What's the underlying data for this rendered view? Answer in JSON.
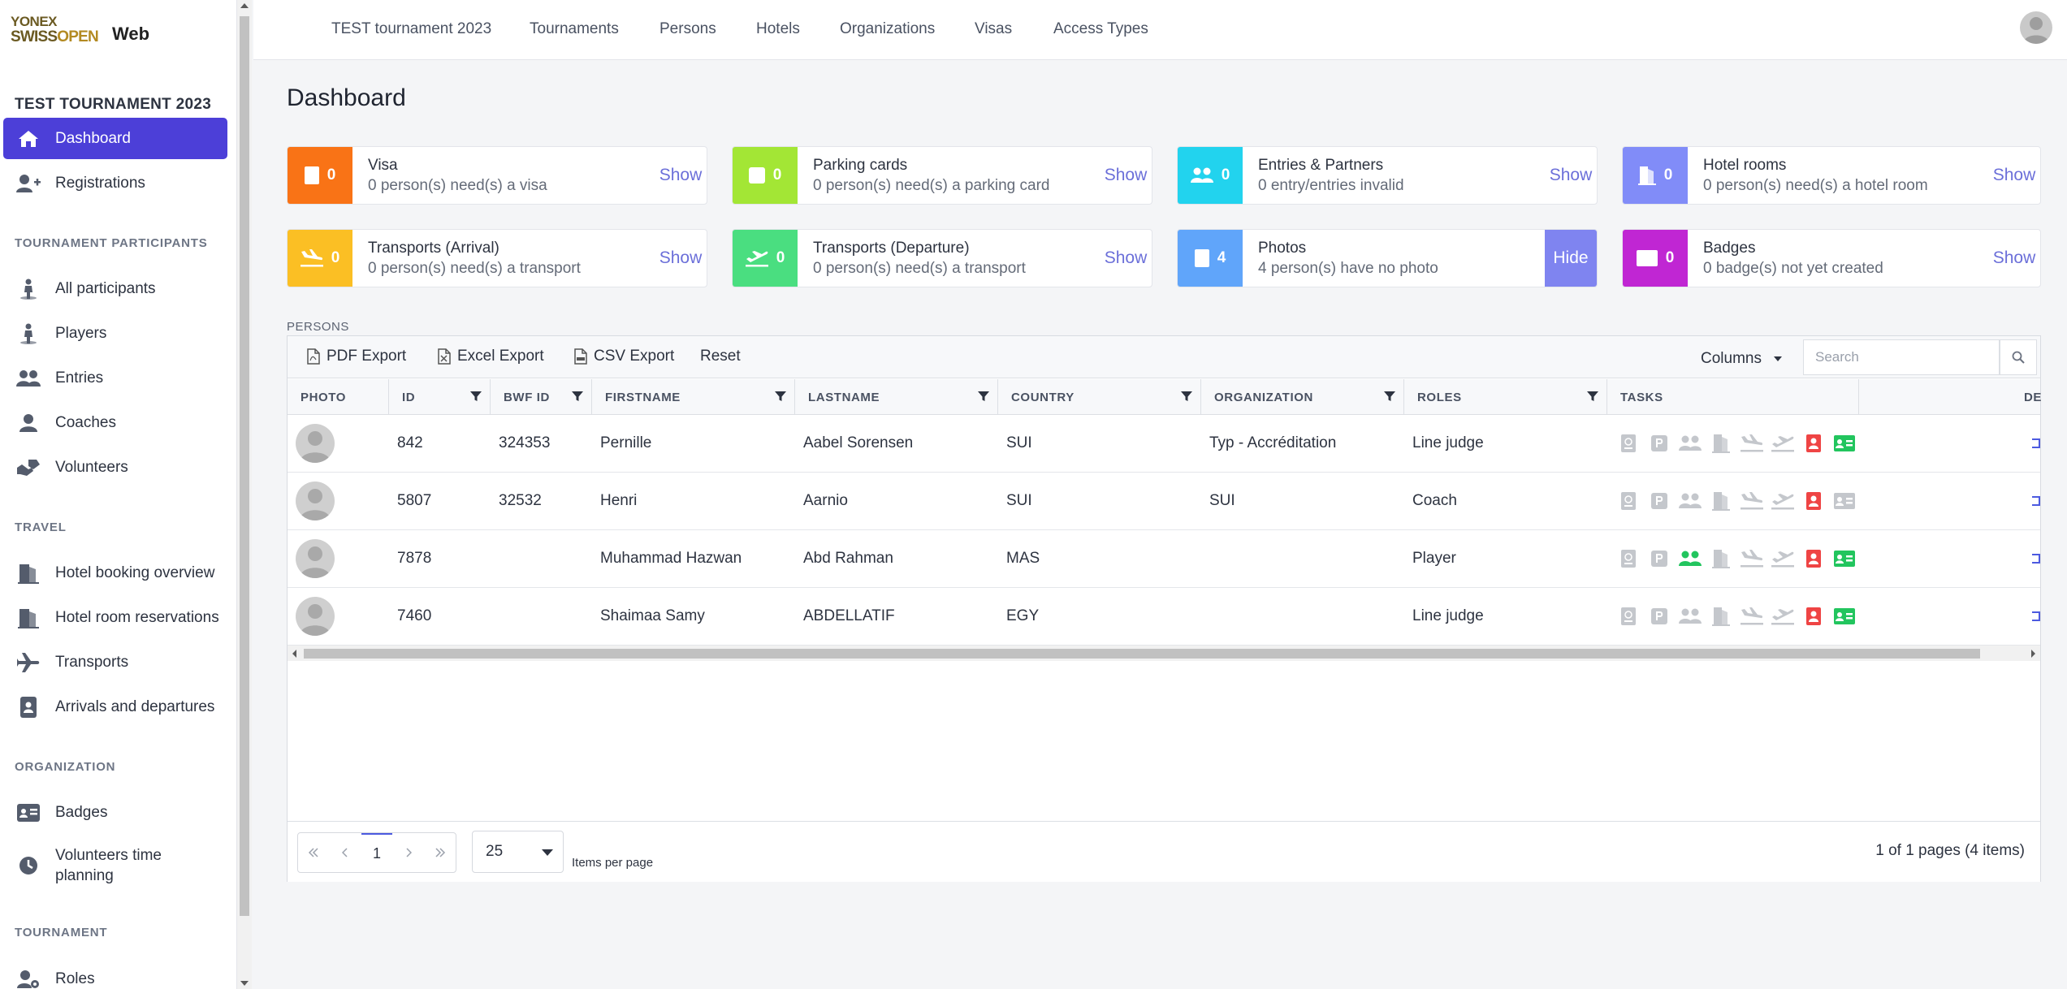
{
  "sidebar": {
    "logo_line1": "YONEX",
    "logo_line2a": "SWISS",
    "logo_line2b": "OPEN",
    "app_name": "Web",
    "tournament_title": "TEST TOURNAMENT 2023",
    "items": [
      {
        "label": "Dashboard",
        "icon": "home-icon",
        "active": true
      },
      {
        "label": "Registrations",
        "icon": "user-plus-icon"
      },
      {
        "label": "All participants",
        "icon": "person-icon"
      },
      {
        "label": "Players",
        "icon": "person-icon"
      },
      {
        "label": "Entries",
        "icon": "users-icon"
      },
      {
        "label": "Coaches",
        "icon": "user-icon"
      },
      {
        "label": "Volunteers",
        "icon": "hands-helping-icon"
      },
      {
        "label": "Hotel booking overview",
        "icon": "hotel-icon"
      },
      {
        "label": "Hotel room reservations",
        "icon": "hotel-icon"
      },
      {
        "label": "Transports",
        "icon": "plane-icon"
      },
      {
        "label": "Arrivals and departures",
        "icon": "id-badge-icon"
      },
      {
        "label": "Badges",
        "icon": "id-card-icon"
      },
      {
        "label": "Volunteers time planning",
        "icon": "clock-icon"
      },
      {
        "label": "Roles",
        "icon": "user-cog-icon"
      }
    ],
    "sections": {
      "participants": "TOURNAMENT PARTICIPANTS",
      "travel": "TRAVEL",
      "organization": "ORGANIZATION",
      "tournament": "TOURNAMENT"
    }
  },
  "topnav": {
    "links": [
      "TEST tournament 2023",
      "Tournaments",
      "Persons",
      "Hotels",
      "Organizations",
      "Visas",
      "Access Types"
    ]
  },
  "page_title": "Dashboard",
  "cards": [
    {
      "title": "Visa",
      "subtitle": "0 person(s) need(s) a visa",
      "count": "0",
      "action": "Show",
      "color": "#f97316",
      "icon": "passport-icon"
    },
    {
      "title": "Parking cards",
      "subtitle": "0 person(s) need(s) a parking card",
      "count": "0",
      "action": "Show",
      "color": "#a3e635",
      "icon": "parking-icon"
    },
    {
      "title": "Entries & Partners",
      "subtitle": "0 entry/entries invalid",
      "count": "0",
      "action": "Show",
      "color": "#22d3ee",
      "icon": "users-icon"
    },
    {
      "title": "Hotel rooms",
      "subtitle": "0 person(s) need(s) a hotel room",
      "count": "0",
      "action": "Show",
      "color": "#818cf8",
      "icon": "hotel-icon"
    },
    {
      "title": "Transports (Arrival)",
      "subtitle": "0 person(s) need(s) a transport",
      "count": "0",
      "action": "Show",
      "color": "#fbbf24",
      "icon": "plane-arrival-icon"
    },
    {
      "title": "Transports (Departure)",
      "subtitle": "0 person(s) need(s) a transport",
      "count": "0",
      "action": "Show",
      "color": "#4ade80",
      "icon": "plane-departure-icon"
    },
    {
      "title": "Photos",
      "subtitle": "4 person(s) have no photo",
      "count": "4",
      "action": "Hide",
      "color": "#60a5fa",
      "icon": "portrait-icon"
    },
    {
      "title": "Badges",
      "subtitle": "0 badge(s) not yet created",
      "count": "0",
      "action": "Show",
      "color": "#c026d3",
      "icon": "id-card-icon"
    }
  ],
  "persons": {
    "label": "PERSONS",
    "toolbar": {
      "pdf": "PDF Export",
      "excel": "Excel Export",
      "csv": "CSV Export",
      "reset": "Reset",
      "columns": "Columns",
      "search_placeholder": "Search"
    },
    "columns": [
      "PHOTO",
      "ID",
      "BWF ID",
      "FIRSTNAME",
      "LASTNAME",
      "COUNTRY",
      "ORGANIZATION",
      "ROLES",
      "TASKS",
      "DE"
    ],
    "rows": [
      {
        "id": "842",
        "bwf_id": "324353",
        "firstname": "Pernille",
        "lastname": "Aabel Sorensen",
        "country": "SUI",
        "organization": "Typ - Accréditation",
        "roles": "Line judge",
        "tasks_done": [
          false,
          false,
          false,
          false,
          false,
          false,
          "red",
          "green"
        ]
      },
      {
        "id": "5807",
        "bwf_id": "32532",
        "firstname": "Henri",
        "lastname": "Aarnio",
        "country": "SUI",
        "organization": "SUI",
        "roles": "Coach",
        "tasks_done": [
          false,
          false,
          false,
          false,
          false,
          false,
          "red",
          false
        ]
      },
      {
        "id": "7878",
        "bwf_id": "",
        "firstname": "Muhammad Hazwan",
        "lastname": "Abd Rahman",
        "country": "MAS",
        "organization": "",
        "roles": "Player",
        "tasks_done": [
          false,
          false,
          "green",
          false,
          false,
          false,
          "red",
          "green"
        ]
      },
      {
        "id": "7460",
        "bwf_id": "",
        "firstname": "Shaimaa Samy",
        "lastname": "ABDELLATIF",
        "country": "EGY",
        "organization": "",
        "roles": "Line judge",
        "tasks_done": [
          false,
          false,
          false,
          false,
          false,
          false,
          "red",
          "green"
        ]
      }
    ],
    "task_icons": [
      "passport-icon",
      "parking-icon",
      "users-icon",
      "hotel-icon",
      "plane-arrival-icon",
      "plane-departure-icon",
      "portrait-icon",
      "id-card-icon"
    ],
    "pager": {
      "current_page": "1",
      "page_size": "25",
      "items_per_page_label": "Items per page",
      "info": "1 of 1 pages (4 items)"
    }
  },
  "colors": {
    "accent": "#4c3fd8",
    "task_grey": "#c4c7cc",
    "task_green": "#22c55e",
    "task_red": "#ef4444"
  }
}
